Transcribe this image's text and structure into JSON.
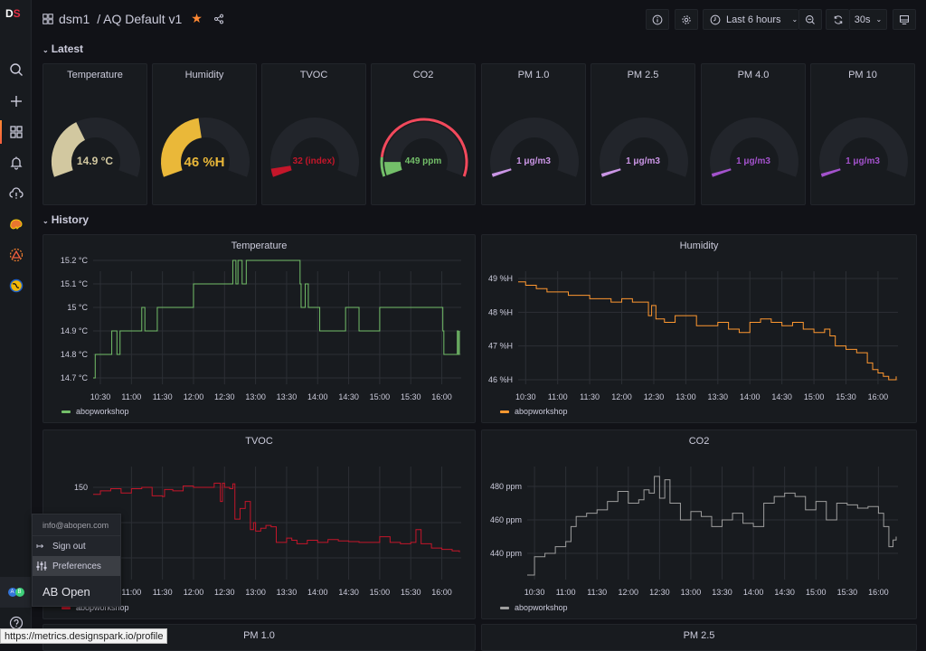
{
  "header": {
    "folder": "dsm1",
    "separator": "/",
    "title": "AQ Default v1",
    "time_range": "Last 6 hours",
    "refresh_interval": "30s"
  },
  "rows": [
    {
      "label": "Latest"
    },
    {
      "label": "History"
    }
  ],
  "gauges": [
    {
      "title": "Temperature",
      "value": "14.9 °C",
      "fill": 0.38,
      "color": "#d2c8a0",
      "text_color": "#d2c8a0",
      "threshold_arc": false
    },
    {
      "title": "Humidity",
      "value": "46 %H",
      "fill": 0.46,
      "color": "#eab839",
      "text_color": "#eab839",
      "threshold_arc": false
    },
    {
      "title": "TVOC",
      "value": "32 (index)",
      "fill": 0.05,
      "color": "#c4162a",
      "text_color": "#c4162a",
      "threshold_arc": false
    },
    {
      "title": "CO2",
      "value": "449 ppm",
      "fill": 0.09,
      "color": "#73bf69",
      "text_color": "#73bf69",
      "threshold_arc": true,
      "threshold_colors": [
        "#73bf69",
        "#f2495c"
      ],
      "threshold_split": 0.12
    },
    {
      "title": "PM 1.0",
      "value": "1 μg/m3",
      "fill": 0.02,
      "color": "#ca95e5",
      "text_color": "#ca95e5",
      "threshold_arc": false
    },
    {
      "title": "PM 2.5",
      "value": "1 μg/m3",
      "fill": 0.02,
      "color": "#ca95e5",
      "text_color": "#ca95e5",
      "threshold_arc": false
    },
    {
      "title": "PM 4.0",
      "value": "1 μg/m3",
      "fill": 0.02,
      "color": "#a352cc",
      "text_color": "#a352cc",
      "threshold_arc": false
    },
    {
      "title": "PM 10",
      "value": "1 μg/m3",
      "fill": 0.02,
      "color": "#a352cc",
      "text_color": "#a352cc",
      "threshold_arc": false
    }
  ],
  "chart_data": [
    {
      "type": "line",
      "title": "Temperature",
      "ylabel": "",
      "xlabel": "",
      "x_ticks": [
        "10:30",
        "11:00",
        "11:30",
        "12:00",
        "12:30",
        "13:00",
        "13:30",
        "14:00",
        "14:30",
        "15:00",
        "15:30",
        "16:00"
      ],
      "y_ticks": [
        "14.7 °C",
        "14.8 °C",
        "14.9 °C",
        "15 °C",
        "15.1 °C",
        "15.2 °C"
      ],
      "ylim": [
        14.7,
        15.2
      ],
      "xlim_minutes": [
        623,
        977
      ],
      "legend": "abopworkshop",
      "color": "#73bf69",
      "series": [
        {
          "name": "abopworkshop",
          "x_minutes": [
            623,
            625,
            625,
            640,
            641,
            645,
            646,
            648,
            649,
            669,
            670,
            672,
            673,
            684,
            685,
            719,
            720,
            757,
            758,
            760,
            761,
            762,
            763,
            766,
            767,
            770,
            771,
            823,
            824,
            827,
            828,
            830,
            831,
            841,
            842,
            866,
            867,
            879,
            880,
            899,
            900,
            961,
            962,
            974,
            975,
            976,
            977
          ],
          "values": [
            14.7,
            14.7,
            14.8,
            14.8,
            14.9,
            14.9,
            14.8,
            14.8,
            14.9,
            14.9,
            15.0,
            15.0,
            14.9,
            14.9,
            15.0,
            15.0,
            15.1,
            15.1,
            15.2,
            15.2,
            15.1,
            15.1,
            15.2,
            15.2,
            15.1,
            15.1,
            15.2,
            15.1,
            15.0,
            15.0,
            15.1,
            15.1,
            15.0,
            15.0,
            14.9,
            14.9,
            15.0,
            15.0,
            14.9,
            14.9,
            15.0,
            14.9,
            14.8,
            14.8,
            14.9,
            14.8,
            14.9
          ]
        }
      ]
    },
    {
      "type": "line",
      "title": "Humidity",
      "ylabel": "",
      "xlabel": "",
      "x_ticks": [
        "10:30",
        "11:00",
        "11:30",
        "12:00",
        "12:30",
        "13:00",
        "13:30",
        "14:00",
        "14:30",
        "15:00",
        "15:30",
        "16:00"
      ],
      "y_ticks": [
        "46 %H",
        "47 %H",
        "48 %H",
        "49 %H"
      ],
      "ylim": [
        45.8,
        49.0
      ],
      "xlim_minutes": [
        623,
        977
      ],
      "legend": "abopworkshop",
      "color": "#ff9830",
      "series": [
        {
          "name": "abopworkshop",
          "x_minutes": [
            623,
            630,
            640,
            650,
            660,
            670,
            680,
            690,
            700,
            710,
            720,
            730,
            740,
            745,
            748,
            752,
            760,
            770,
            780,
            790,
            800,
            810,
            820,
            830,
            840,
            850,
            860,
            870,
            880,
            890,
            900,
            910,
            915,
            920,
            930,
            940,
            950,
            955,
            960,
            965,
            970,
            977
          ],
          "values": [
            48.9,
            48.8,
            48.7,
            48.6,
            48.6,
            48.5,
            48.5,
            48.4,
            48.4,
            48.3,
            48.4,
            48.3,
            48.3,
            47.9,
            48.2,
            47.8,
            47.7,
            47.9,
            47.9,
            47.6,
            47.6,
            47.7,
            47.5,
            47.4,
            47.7,
            47.8,
            47.7,
            47.6,
            47.7,
            47.5,
            47.4,
            47.5,
            47.3,
            47.0,
            46.9,
            46.8,
            46.5,
            46.3,
            46.2,
            46.1,
            46.0,
            46.1
          ]
        }
      ]
    },
    {
      "type": "line",
      "title": "TVOC",
      "ylabel": "",
      "xlabel": "",
      "x_ticks": [
        "11:00",
        "11:30",
        "12:00",
        "12:30",
        "13:00",
        "13:30",
        "14:00",
        "14:30",
        "15:00",
        "15:30",
        "16:00"
      ],
      "y_ticks": [
        "150"
      ],
      "ylim": [
        30,
        165
      ],
      "xlim_minutes": [
        623,
        977
      ],
      "legend": "abopworkshop",
      "color": "#c4162a",
      "series": [
        {
          "name": "abopworkshop",
          "x_minutes": [
            623,
            630,
            640,
            650,
            660,
            670,
            680,
            690,
            692,
            700,
            710,
            720,
            730,
            740,
            746,
            748,
            750,
            755,
            758,
            760,
            765,
            770,
            775,
            778,
            780,
            785,
            790,
            795,
            800,
            810,
            815,
            820,
            830,
            840,
            850,
            860,
            870,
            880,
            890,
            900,
            910,
            920,
            930,
            935,
            940,
            950,
            960,
            970,
            977
          ],
          "values": [
            140,
            145,
            148,
            142,
            148,
            150,
            138,
            137,
            147,
            145,
            152,
            150,
            150,
            156,
            130,
            156,
            150,
            148,
            155,
            105,
            120,
            130,
            90,
            100,
            88,
            92,
            96,
            94,
            72,
            78,
            75,
            70,
            75,
            72,
            76,
            74,
            73,
            72,
            72,
            80,
            72,
            70,
            72,
            90,
            70,
            64,
            62,
            60,
            58
          ]
        }
      ]
    },
    {
      "type": "line",
      "title": "CO2",
      "ylabel": "",
      "xlabel": "",
      "x_ticks": [
        "10:30",
        "11:00",
        "11:30",
        "12:00",
        "12:30",
        "13:00",
        "13:30",
        "14:00",
        "14:30",
        "15:00",
        "15:30",
        "16:00"
      ],
      "y_ticks": [
        "440 ppm",
        "460 ppm",
        "480 ppm"
      ],
      "ylim": [
        425,
        490
      ],
      "xlim_minutes": [
        623,
        977
      ],
      "legend": "abopworkshop",
      "color": "#9e9e9e",
      "series": [
        {
          "name": "abopworkshop",
          "x_minutes": [
            623,
            630,
            640,
            650,
            660,
            665,
            670,
            680,
            690,
            700,
            710,
            720,
            730,
            735,
            740,
            745,
            750,
            755,
            760,
            770,
            780,
            790,
            800,
            810,
            820,
            830,
            840,
            850,
            860,
            870,
            880,
            890,
            900,
            910,
            920,
            930,
            940,
            950,
            960,
            965,
            970,
            974,
            977
          ],
          "values": [
            427,
            438,
            440,
            444,
            447,
            456,
            462,
            464,
            466,
            471,
            477,
            470,
            472,
            478,
            476,
            486,
            473,
            484,
            470,
            460,
            465,
            462,
            456,
            460,
            464,
            458,
            456,
            470,
            474,
            476,
            474,
            466,
            471,
            460,
            470,
            469,
            467,
            468,
            464,
            456,
            444,
            448,
            450
          ]
        }
      ]
    }
  ],
  "bottom_panels": [
    {
      "title": "PM 1.0"
    },
    {
      "title": "PM 2.5"
    }
  ],
  "user_menu": {
    "email": "info@abopen.com",
    "sign_out": "Sign out",
    "preferences": "Preferences",
    "org_name": "AB Open"
  },
  "avatar": {
    "letters": [
      "A",
      "B"
    ]
  },
  "status_url": "https://metrics.designspark.io/profile"
}
